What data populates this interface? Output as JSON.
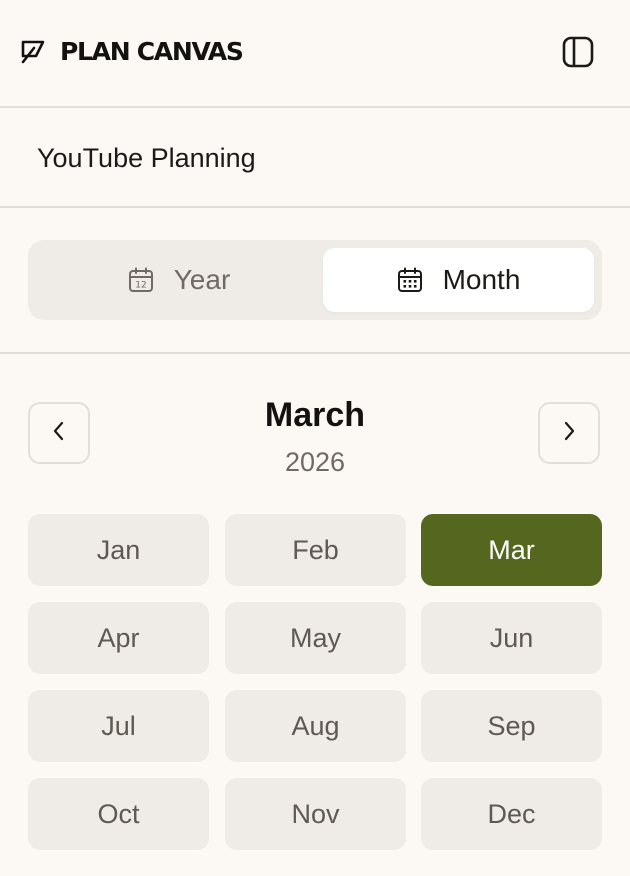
{
  "app": {
    "logo_text": "PLAN CANVAS",
    "logo_icon": "leaf-icon",
    "sidebar_toggle_icon": "sidebar-panel-icon"
  },
  "project": {
    "title": "YouTube Planning"
  },
  "view_toggle": {
    "options": [
      {
        "label": "Year",
        "icon": "calendar-12-icon",
        "selected": false
      },
      {
        "label": "Month",
        "icon": "calendar-grid-icon",
        "selected": true
      }
    ]
  },
  "navigator": {
    "month": "March",
    "year": "2026",
    "prev_icon": "chevron-left-icon",
    "next_icon": "chevron-right-icon"
  },
  "months": [
    {
      "label": "Jan",
      "selected": false
    },
    {
      "label": "Feb",
      "selected": false
    },
    {
      "label": "Mar",
      "selected": true
    },
    {
      "label": "Apr",
      "selected": false
    },
    {
      "label": "May",
      "selected": false
    },
    {
      "label": "Jun",
      "selected": false
    },
    {
      "label": "Jul",
      "selected": false
    },
    {
      "label": "Aug",
      "selected": false
    },
    {
      "label": "Sep",
      "selected": false
    },
    {
      "label": "Oct",
      "selected": false
    },
    {
      "label": "Nov",
      "selected": false
    },
    {
      "label": "Dec",
      "selected": false
    }
  ],
  "colors": {
    "background": "#fcf9f4",
    "accent": "#55661f",
    "chip": "#efebe6",
    "border": "#e3ded7",
    "muted_text": "#6f6a63"
  }
}
